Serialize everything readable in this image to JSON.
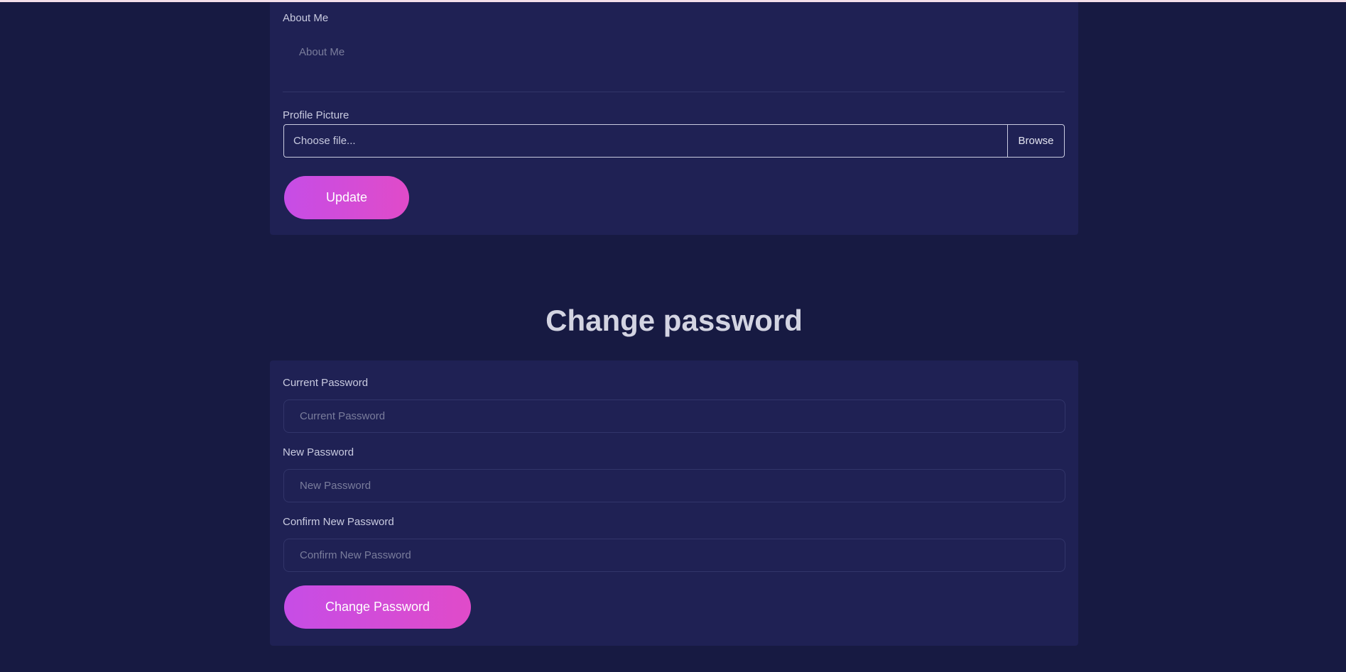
{
  "profile": {
    "about_me_label": "About Me",
    "about_me_placeholder": "About Me",
    "picture_label": "Profile Picture",
    "file_placeholder": "Choose file...",
    "browse_label": "Browse",
    "update_button": "Update"
  },
  "password": {
    "title": "Change password",
    "current_label": "Current Password",
    "current_placeholder": "Current Password",
    "new_label": "New Password",
    "new_placeholder": "New Password",
    "confirm_label": "Confirm New Password",
    "confirm_placeholder": "Confirm New Password",
    "submit_button": "Change Password"
  },
  "colors": {
    "page_background": "#171a42",
    "card_background": "#1f2154",
    "accent_gradient_start": "#c64de6",
    "accent_gradient_end": "#e04bc9"
  }
}
